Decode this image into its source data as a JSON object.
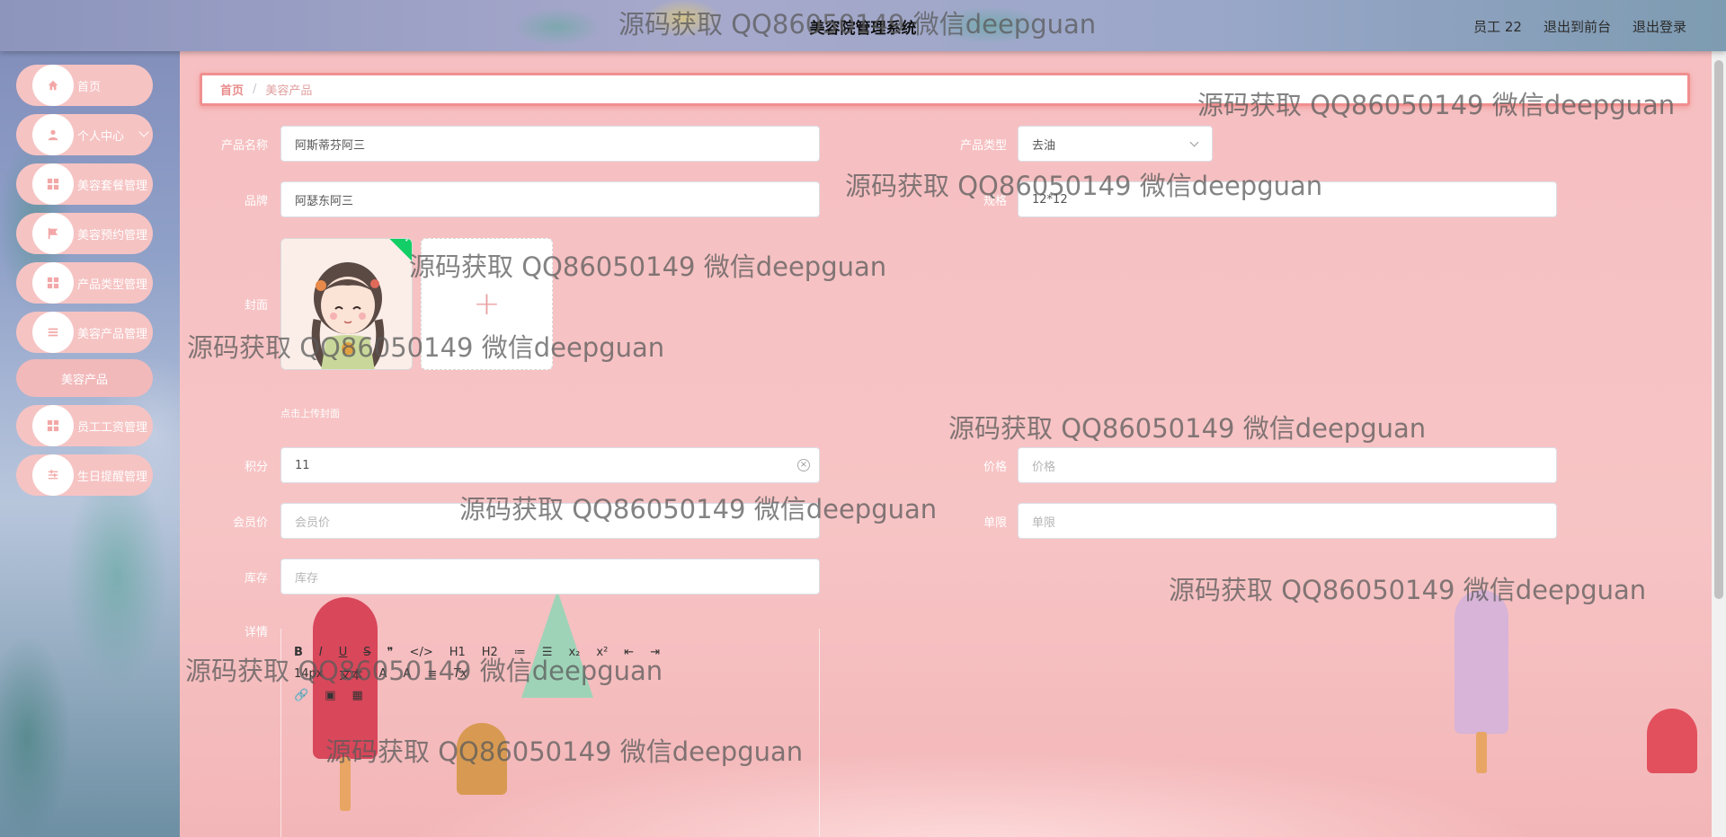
{
  "header": {
    "title": "美容院管理系统",
    "user": "员工 22",
    "back_to_front": "退出到前台",
    "logout": "退出登录"
  },
  "sidebar": {
    "items": [
      {
        "label": "首页",
        "icon": "home-icon"
      },
      {
        "label": "个人中心",
        "icon": "user-icon"
      },
      {
        "label": "美容套餐管理",
        "icon": "grid-icon"
      },
      {
        "label": "美容预约管理",
        "icon": "flag-icon"
      },
      {
        "label": "产品类型管理",
        "icon": "grid-icon"
      },
      {
        "label": "美容产品管理",
        "icon": "list-icon"
      },
      {
        "label": "美容产品",
        "icon": ""
      },
      {
        "label": "员工工资管理",
        "icon": "grid-icon"
      },
      {
        "label": "生日提醒管理",
        "icon": "sliders-icon"
      }
    ]
  },
  "breadcrumb": {
    "home": "首页",
    "separator": "/",
    "current": "美容产品"
  },
  "form": {
    "product_name": {
      "label": "产品名称",
      "value": "阿斯蒂芬阿三"
    },
    "product_type": {
      "label": "产品类型",
      "value": "去油"
    },
    "brand": {
      "label": "品牌",
      "value": "阿瑟东阿三"
    },
    "spec": {
      "label": "规格",
      "value": "12*12"
    },
    "cover": {
      "label": "封面",
      "upload_tip": "点击上传封面",
      "add_symbol": "+"
    },
    "points": {
      "label": "积分",
      "value": "11"
    },
    "price": {
      "label": "价格",
      "placeholder": "价格"
    },
    "member_price": {
      "label": "会员价",
      "placeholder": "会员价"
    },
    "limit": {
      "label": "单限",
      "placeholder": "单限"
    },
    "stock": {
      "label": "库存",
      "placeholder": "库存"
    },
    "details": {
      "label": "详情"
    }
  },
  "editor": {
    "row1": [
      "B",
      "I",
      "U",
      "S",
      "❞",
      "</>",
      "H1",
      "H2",
      "≔",
      "☰",
      "x₂",
      "x²",
      "⇤",
      "⇥"
    ],
    "row2": [
      "14px",
      "文本",
      "A",
      "A",
      "≡",
      "Tx"
    ],
    "row3": [
      "🔗",
      "▣",
      "▦"
    ]
  },
  "watermark": "源码获取 QQ86050149 微信deepguan",
  "colors": {
    "accent": "#f08f8f",
    "menu_bg": "#f6c3c3",
    "success": "#13ce66"
  }
}
